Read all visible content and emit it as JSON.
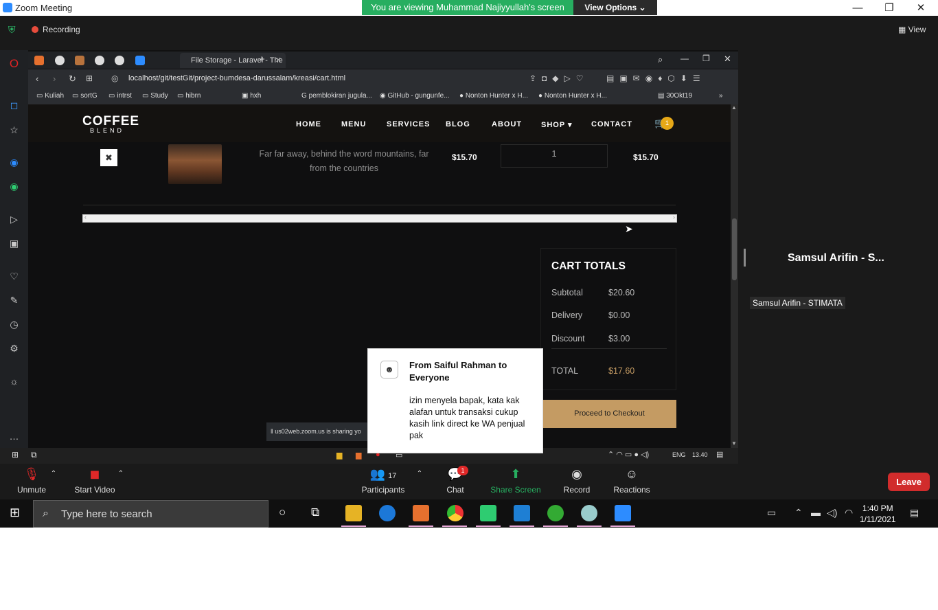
{
  "zoom": {
    "window_title": "Zoom Meeting",
    "banner_text": "You are viewing Muhammad Najiyyullah's screen",
    "view_options": "View Options ⌄",
    "recording_label": "Recording",
    "view_label": "View"
  },
  "browser": {
    "active_tab_title": "File Storage - Laravel - The",
    "url": "localhost/git/testGit/project-bumdesa-darussalam/kreasi/cart.html",
    "bookmarks": [
      "Kuliah",
      "sortG",
      "intrst",
      "Study",
      "hibrn",
      "hxh",
      "pemblokiran jugula...",
      "GitHub - gungunfe...",
      "Nonton Hunter x H...",
      "Nonton Hunter x H...",
      "30Okt19"
    ]
  },
  "site": {
    "logo_top": "COFFEE",
    "logo_bottom": "BLEND",
    "nav": [
      "HOME",
      "MENU",
      "SERVICES",
      "BLOG",
      "ABOUT",
      "SHOP ▾",
      "CONTACT"
    ],
    "cart_count": "1",
    "cart_row": {
      "remove": "✖",
      "description": "Far far away, behind the word mountains, far from the countries",
      "price": "$15.70",
      "quantity": "1",
      "total": "$15.70"
    },
    "totals": {
      "title": "CART TOTALS",
      "subtotal_label": "Subtotal",
      "subtotal": "$20.60",
      "delivery_label": "Delivery",
      "delivery": "$0.00",
      "discount_label": "Discount",
      "discount": "$3.00",
      "total_label": "TOTAL",
      "total": "$17.60"
    },
    "checkout": "Proceed to Checkout"
  },
  "share_notice": "us02web.zoom.us is sharing yo",
  "chat_popup": {
    "from": "From Saiful Rahman to Everyone",
    "message": "izin menyela bapak, kata kak alafan untuk transaksi cukup kasih link direct ke WA penjual pak"
  },
  "remote_tray": {
    "lang": "ENG",
    "time": "13.40"
  },
  "participant": {
    "name_big": "Samsul Arifin - S...",
    "name_label": "Samsul Arifin - STIMATA"
  },
  "toolbar": {
    "unmute": "Unmute",
    "start_video": "Start Video",
    "participants_count": "17",
    "participants": "Participants",
    "chat": "Chat",
    "chat_badge": "1",
    "share_screen": "Share Screen",
    "record": "Record",
    "reactions": "Reactions",
    "leave": "Leave"
  },
  "taskbar": {
    "search_placeholder": "Type here to search",
    "time": "1:40 PM",
    "date": "1/11/2021"
  },
  "colors": {
    "banner_green": "#27ae60",
    "checkout_gold": "#c49b63",
    "leave_red": "#d12c2c",
    "cart_badge": "#e6a817"
  }
}
